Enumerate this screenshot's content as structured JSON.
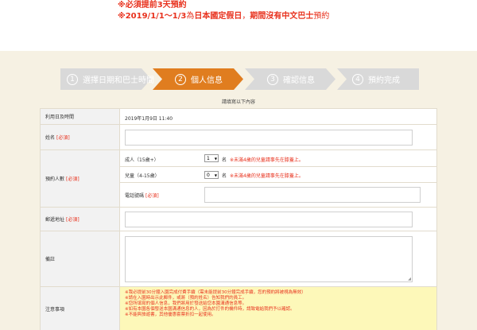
{
  "notice": {
    "line1": "※必須提前3天預約",
    "line2_bold": "※2019/1/1〜1/3",
    "line2_mid": "為",
    "line2_bold2": "日本國定假日",
    "line2_mid2": "，",
    "line2_bold3": "期間沒有中文巴士",
    "line2_end": "預約"
  },
  "steps": [
    {
      "num": "1",
      "label": "選擇日期和巴士時間",
      "state": "done",
      "color": "#d9d9d9"
    },
    {
      "num": "2",
      "label": "個人信息",
      "state": "active",
      "color": "#e07d1f"
    },
    {
      "num": "3",
      "label": "確認信息",
      "state": "todo",
      "color": "#d9d9d9"
    },
    {
      "num": "4",
      "label": "預約完成",
      "state": "todo",
      "color": "#d9d9d9"
    }
  ],
  "subtitle": "請填寫以下內容",
  "form": {
    "date_label": "利用日及時間",
    "date_value": "2019年1月9日 11:40",
    "name_label": "姓名",
    "required": "[必須]",
    "people_label": "預約人數",
    "adult_label": "成人（15歲+）",
    "adult_value": "1",
    "child_label": "兒童（4-15歲）",
    "child_value": "0",
    "unit": "名",
    "hint": "※未滿4歲的兒童請事先在膝蓋上。",
    "phone_label": "電話號碼",
    "zip_label": "郵遞地址",
    "remarks_label": "備註",
    "notes_label": "注意事項",
    "notes": [
      "※我必提前30分鐘入園完成付費手續（需未能提前30分鐘完成手續，您的預約將被視為無效）",
      "※請在入園時出示此郵件，或將（預約姓名）告知我們的員工。",
      "※您所填寫的個人信息，我們將用於發送給您本園溝通信息等。",
      "※如有本園各個發送本園溝通信息的人，因為於打件的機件時，請致電給我們予以確認。",
      "※不能與旅遊書，其他優惠套票折扣一起使用。"
    ]
  }
}
